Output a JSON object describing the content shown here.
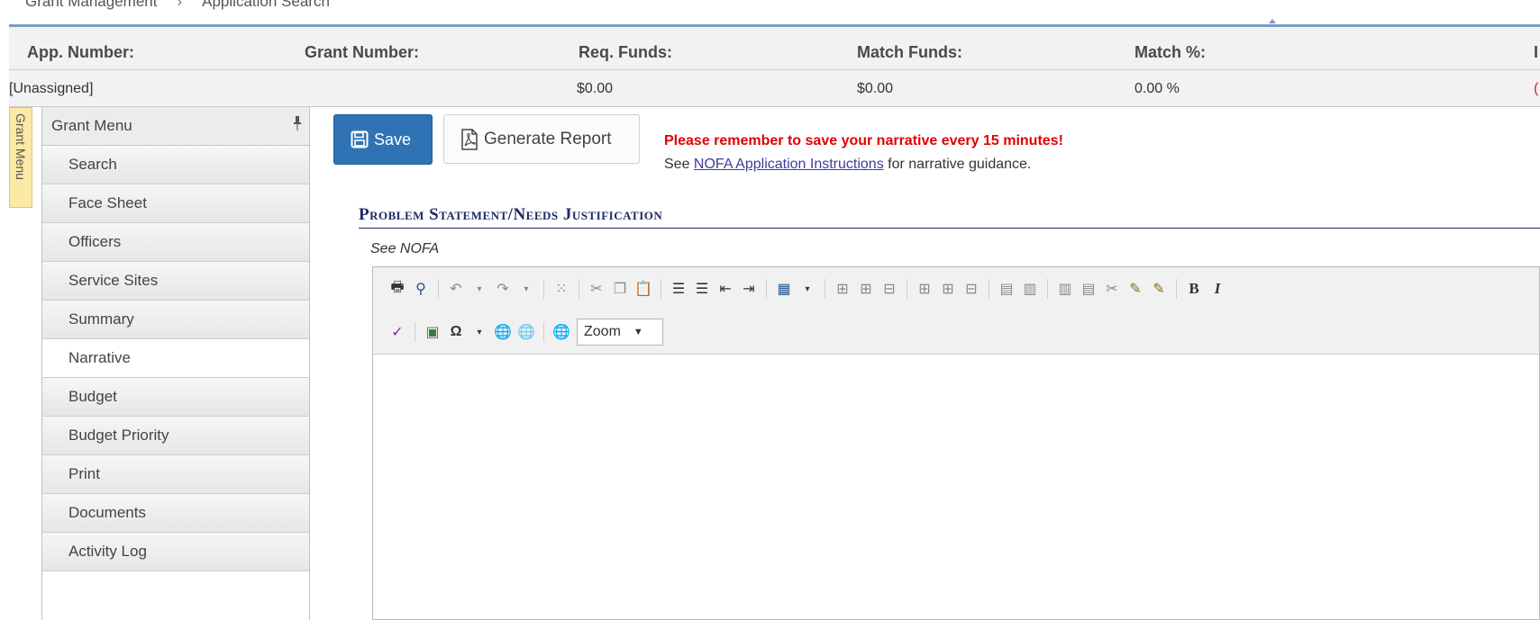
{
  "breadcrumb": [
    "Grant Management",
    "Application Search"
  ],
  "summary": {
    "headers": [
      "App. Number:",
      "Grant Number:",
      "Req. Funds:",
      "Match Funds:",
      "Match %:",
      "I"
    ],
    "values": [
      "[Unassigned]",
      "",
      "$0.00",
      "$0.00",
      "0.00 %",
      "("
    ]
  },
  "side_tab": {
    "label": "Grant Menu"
  },
  "menu": {
    "title": "Grant Menu",
    "items": [
      "Search",
      "Face Sheet",
      "Officers",
      "Service Sites",
      "Summary",
      "Narrative",
      "Budget",
      "Budget Priority",
      "Print",
      "Documents",
      "Activity Log"
    ],
    "active": "Narrative"
  },
  "actions": {
    "save": "Save",
    "report": "Generate Report"
  },
  "notice": "Please remember to save your narrative every 15 minutes!",
  "guidance": {
    "prefix": "See ",
    "link": "NOFA Application Instructions",
    "suffix": " for narrative guidance."
  },
  "section": {
    "title": "Problem Statement/Needs Justification",
    "hint": "See NOFA"
  },
  "editor": {
    "zoom_label": "Zoom",
    "bold": "B",
    "italic": "I"
  },
  "colors": {
    "primary": "#2f73b4",
    "notice": "#e00000",
    "section": "#1f2a66",
    "tab": "#fbe9a6"
  }
}
